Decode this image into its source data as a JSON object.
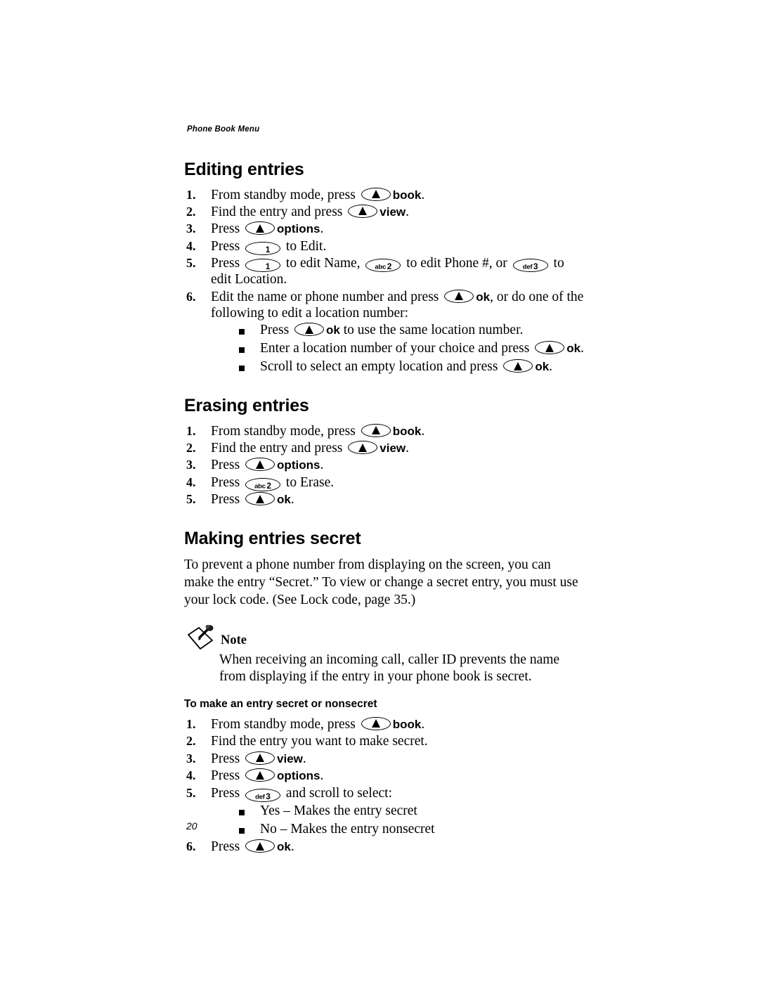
{
  "page": {
    "running_header": "Phone Book Menu",
    "folio": "20"
  },
  "icons": {
    "softkey": "softkey-up-triangle-icon",
    "key_1": {
      "letters": "",
      "digit": "1"
    },
    "key_2": {
      "letters": "abc",
      "digit": "2"
    },
    "key_3": {
      "letters": "def",
      "digit": "3"
    },
    "note": "note-pencil-icon"
  },
  "sections": [
    {
      "title": "Editing entries",
      "steps": [
        {
          "num": "1.",
          "parts": [
            {
              "t": "text",
              "v": "From standby mode, press "
            },
            {
              "t": "softkey"
            },
            {
              "t": "bold",
              "v": "book"
            },
            {
              "t": "text",
              "v": "."
            }
          ]
        },
        {
          "num": "2.",
          "parts": [
            {
              "t": "text",
              "v": "Find the entry and press "
            },
            {
              "t": "softkey"
            },
            {
              "t": "bold",
              "v": "view"
            },
            {
              "t": "text",
              "v": "."
            }
          ]
        },
        {
          "num": "3.",
          "parts": [
            {
              "t": "text",
              "v": "Press "
            },
            {
              "t": "softkey"
            },
            {
              "t": "bold",
              "v": "options"
            },
            {
              "t": "text",
              "v": "."
            }
          ]
        },
        {
          "num": "4.",
          "parts": [
            {
              "t": "text",
              "v": "Press "
            },
            {
              "t": "numkey",
              "k": "key_1"
            },
            {
              "t": "text",
              "v": " to Edit."
            }
          ]
        },
        {
          "num": "5.",
          "parts": [
            {
              "t": "text",
              "v": "Press "
            },
            {
              "t": "numkey",
              "k": "key_1"
            },
            {
              "t": "text",
              "v": " to edit Name, "
            },
            {
              "t": "numkey",
              "k": "key_2"
            },
            {
              "t": "text",
              "v": " to edit Phone #, or "
            },
            {
              "t": "numkey",
              "k": "key_3"
            },
            {
              "t": "text",
              "v": " to edit Location."
            }
          ]
        },
        {
          "num": "6.",
          "parts": [
            {
              "t": "text",
              "v": "Edit the name or phone number and press "
            },
            {
              "t": "softkey"
            },
            {
              "t": "bold",
              "v": "ok"
            },
            {
              "t": "text",
              "v": ", or do one of the following to edit a location number:"
            }
          ],
          "bullets": [
            [
              {
                "t": "text",
                "v": "Press "
              },
              {
                "t": "softkey"
              },
              {
                "t": "bold",
                "v": "ok"
              },
              {
                "t": "text",
                "v": " to use the same location number."
              }
            ],
            [
              {
                "t": "text",
                "v": "Enter a location number of your choice and press "
              },
              {
                "t": "softkey"
              },
              {
                "t": "bold",
                "v": "ok"
              },
              {
                "t": "text",
                "v": "."
              }
            ],
            [
              {
                "t": "text",
                "v": "Scroll to select an empty location and press "
              },
              {
                "t": "softkey"
              },
              {
                "t": "bold",
                "v": "ok"
              },
              {
                "t": "text",
                "v": "."
              }
            ]
          ]
        }
      ]
    },
    {
      "title": "Erasing entries",
      "steps": [
        {
          "num": "1.",
          "parts": [
            {
              "t": "text",
              "v": "From standby mode, press "
            },
            {
              "t": "softkey"
            },
            {
              "t": "bold",
              "v": "book"
            },
            {
              "t": "text",
              "v": "."
            }
          ]
        },
        {
          "num": "2.",
          "parts": [
            {
              "t": "text",
              "v": "Find the entry and press "
            },
            {
              "t": "softkey"
            },
            {
              "t": "bold",
              "v": "view"
            },
            {
              "t": "text",
              "v": "."
            }
          ]
        },
        {
          "num": "3.",
          "parts": [
            {
              "t": "text",
              "v": "Press "
            },
            {
              "t": "softkey"
            },
            {
              "t": "bold",
              "v": "options"
            },
            {
              "t": "text",
              "v": "."
            }
          ]
        },
        {
          "num": "4.",
          "parts": [
            {
              "t": "text",
              "v": "Press "
            },
            {
              "t": "numkey",
              "k": "key_2"
            },
            {
              "t": "text",
              "v": " to Erase."
            }
          ]
        },
        {
          "num": "5.",
          "parts": [
            {
              "t": "text",
              "v": "Press "
            },
            {
              "t": "softkey"
            },
            {
              "t": "bold",
              "v": "ok"
            },
            {
              "t": "text",
              "v": "."
            }
          ]
        }
      ]
    }
  ],
  "secret_section": {
    "title": "Making entries secret",
    "intro": "To prevent a phone number from displaying on the screen, you can make the entry “Secret.” To view or change a secret entry, you must use your lock code. (See Lock code, page 35.)",
    "note_label": "Note",
    "note_text": "When receiving an incoming call, caller ID prevents the name from displaying if the entry in your phone book is secret.",
    "sub_title": "To make an entry secret or nonsecret",
    "steps": [
      {
        "num": "1.",
        "parts": [
          {
            "t": "text",
            "v": "From standby mode, press "
          },
          {
            "t": "softkey"
          },
          {
            "t": "bold",
            "v": "book"
          },
          {
            "t": "text",
            "v": "."
          }
        ]
      },
      {
        "num": "2.",
        "parts": [
          {
            "t": "text",
            "v": "Find the entry you want to make secret."
          }
        ]
      },
      {
        "num": "3.",
        "parts": [
          {
            "t": "text",
            "v": "Press "
          },
          {
            "t": "softkey"
          },
          {
            "t": "bold",
            "v": "view"
          },
          {
            "t": "text",
            "v": "."
          }
        ]
      },
      {
        "num": "4.",
        "parts": [
          {
            "t": "text",
            "v": "Press "
          },
          {
            "t": "softkey"
          },
          {
            "t": "bold",
            "v": "options"
          },
          {
            "t": "text",
            "v": "."
          }
        ]
      },
      {
        "num": "5.",
        "parts": [
          {
            "t": "text",
            "v": "Press "
          },
          {
            "t": "numkey",
            "k": "key_3"
          },
          {
            "t": "text",
            "v": " and scroll to select:"
          }
        ],
        "bullets": [
          [
            {
              "t": "text",
              "v": "Yes – Makes the entry secret"
            }
          ],
          [
            {
              "t": "text",
              "v": "No – Makes the entry nonsecret"
            }
          ]
        ]
      },
      {
        "num": "6.",
        "parts": [
          {
            "t": "text",
            "v": "Press "
          },
          {
            "t": "softkey"
          },
          {
            "t": "bold",
            "v": "ok"
          },
          {
            "t": "text",
            "v": "."
          }
        ]
      }
    ]
  }
}
